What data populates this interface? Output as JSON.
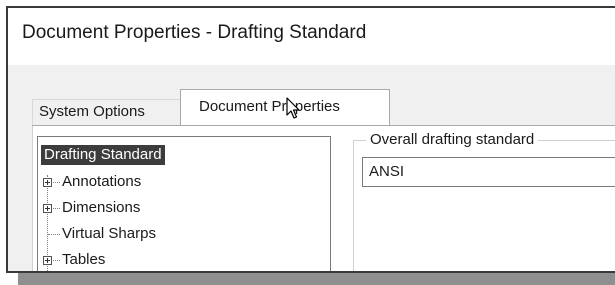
{
  "window": {
    "title": "Document Properties - Drafting Standard"
  },
  "tabs": [
    {
      "label": "System Options",
      "active": false
    },
    {
      "label": "Document Properties",
      "active": true
    }
  ],
  "tree": {
    "root": {
      "label": "Drafting Standard",
      "selected": true
    },
    "children": [
      {
        "label": "Annotations",
        "expandable": true
      },
      {
        "label": "Dimensions",
        "expandable": true
      },
      {
        "label": "Virtual Sharps",
        "expandable": false
      },
      {
        "label": "Tables",
        "expandable": true
      }
    ]
  },
  "overall_standard": {
    "group_label": "Overall drafting standard",
    "value": "ANSI"
  },
  "icons": {
    "cursor": "mouse-pointer-icon",
    "expander": "plus-expander-icon"
  },
  "colors": {
    "selection_bg": "#3c3c3c",
    "selection_text": "#ffffff",
    "dialog_bg": "#f0f0f0"
  }
}
